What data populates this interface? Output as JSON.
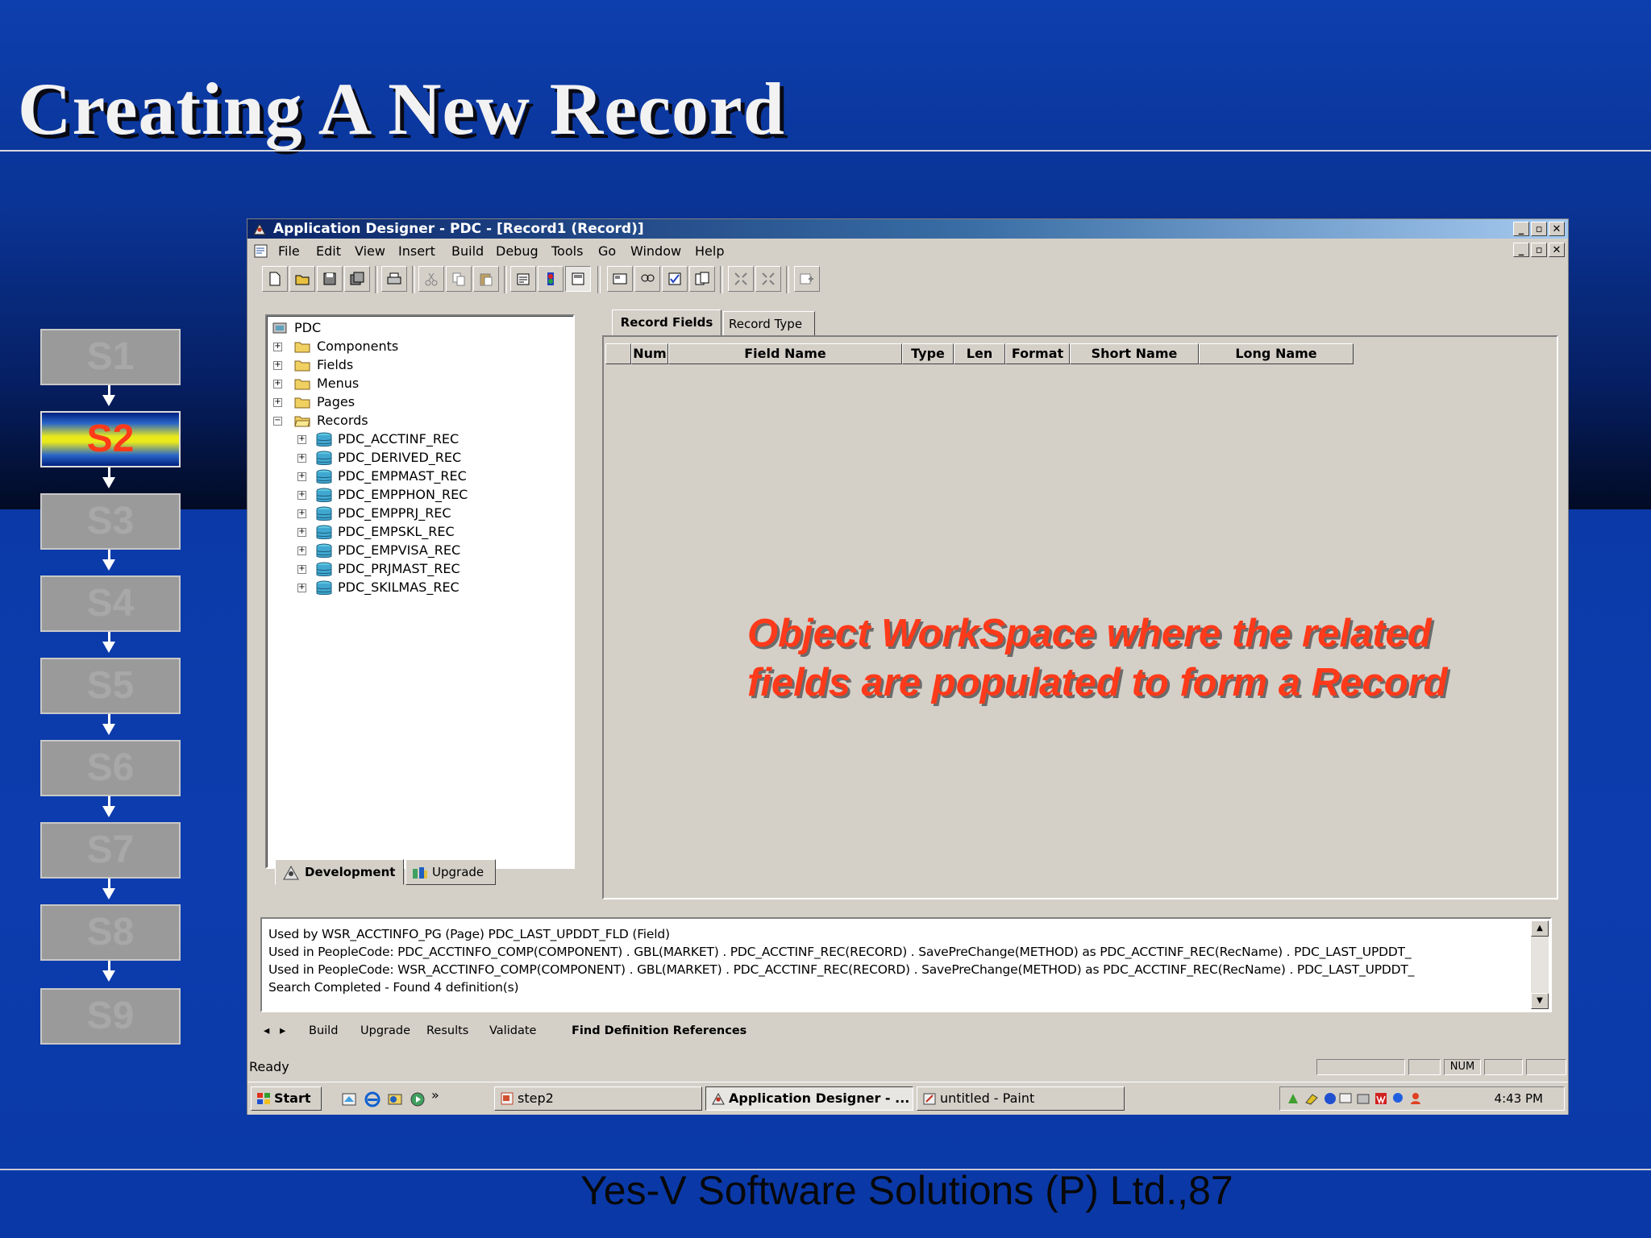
{
  "slide": {
    "title": "Creating A New Record",
    "footer": "Yes-V Software Solutions (P) Ltd.,87",
    "steps": [
      "S1",
      "S2",
      "S3",
      "S4",
      "S5",
      "S6",
      "S7",
      "S8",
      "S9"
    ],
    "active_step": "S2",
    "annotation_line1": "Object WorkSpace where the related",
    "annotation_line2": "fields are populated to form a Record",
    "colors": {
      "annotation": "#ff3a1a",
      "active_step_text": "#ff3a1a",
      "background": "#0c3ba6"
    }
  },
  "app": {
    "title": "Application Designer - PDC - [Record1 (Record)]",
    "menu": [
      "File",
      "Edit",
      "View",
      "Insert",
      "Build",
      "Debug",
      "Tools",
      "Go",
      "Window",
      "Help"
    ],
    "tree": {
      "root": "PDC",
      "folders": [
        "Components",
        "Fields",
        "Menus",
        "Pages",
        "Records"
      ],
      "records": [
        "PDC_ACCTINF_REC",
        "PDC_DERIVED_REC",
        "PDC_EMPMAST_REC",
        "PDC_EMPPHON_REC",
        "PDC_EMPPRJ_REC",
        "PDC_EMPSKL_REC",
        "PDC_EMPVISA_REC",
        "PDC_PRJMAST_REC",
        "PDC_SKILMAS_REC"
      ]
    },
    "panel_tabs": [
      "Development",
      "Upgrade"
    ],
    "workspace_tabs": [
      "Record Fields",
      "Record Type"
    ],
    "columns": [
      "Num",
      "Field Name",
      "Type",
      "Len",
      "Format",
      "Short Name",
      "Long Name"
    ],
    "output": {
      "lines": [
        "Used by    WSR_ACCTINFO_PG (Page)    PDC_LAST_UPDDT_FLD (Field)",
        "Used in PeopleCode: PDC_ACCTINFO_COMP(COMPONENT) . GBL(MARKET) . PDC_ACCTINF_REC(RECORD) . SavePreChange(METHOD)  as  PDC_ACCTINF_REC(RecName) . PDC_LAST_UPDDT_",
        "Used in PeopleCode: WSR_ACCTINFO_COMP(COMPONENT) . GBL(MARKET) . PDC_ACCTINF_REC(RECORD) . SavePreChange(METHOD)  as  PDC_ACCTINF_REC(RecName) . PDC_LAST_UPDDT_",
        "Search Completed - Found 4 definition(s)"
      ],
      "tabs": [
        "Build",
        "Upgrade",
        "Results",
        "Validate",
        "Find Definition References"
      ]
    },
    "status": {
      "text": "Ready",
      "num": "NUM"
    },
    "taskbar": {
      "start": "Start",
      "chevron": "»",
      "items": [
        "step2",
        "Application Designer - ...",
        "untitled - Paint"
      ],
      "time": "4:43 PM"
    },
    "window_buttons": {
      "minimize": "_",
      "restore": "▫",
      "close": "✕"
    }
  }
}
